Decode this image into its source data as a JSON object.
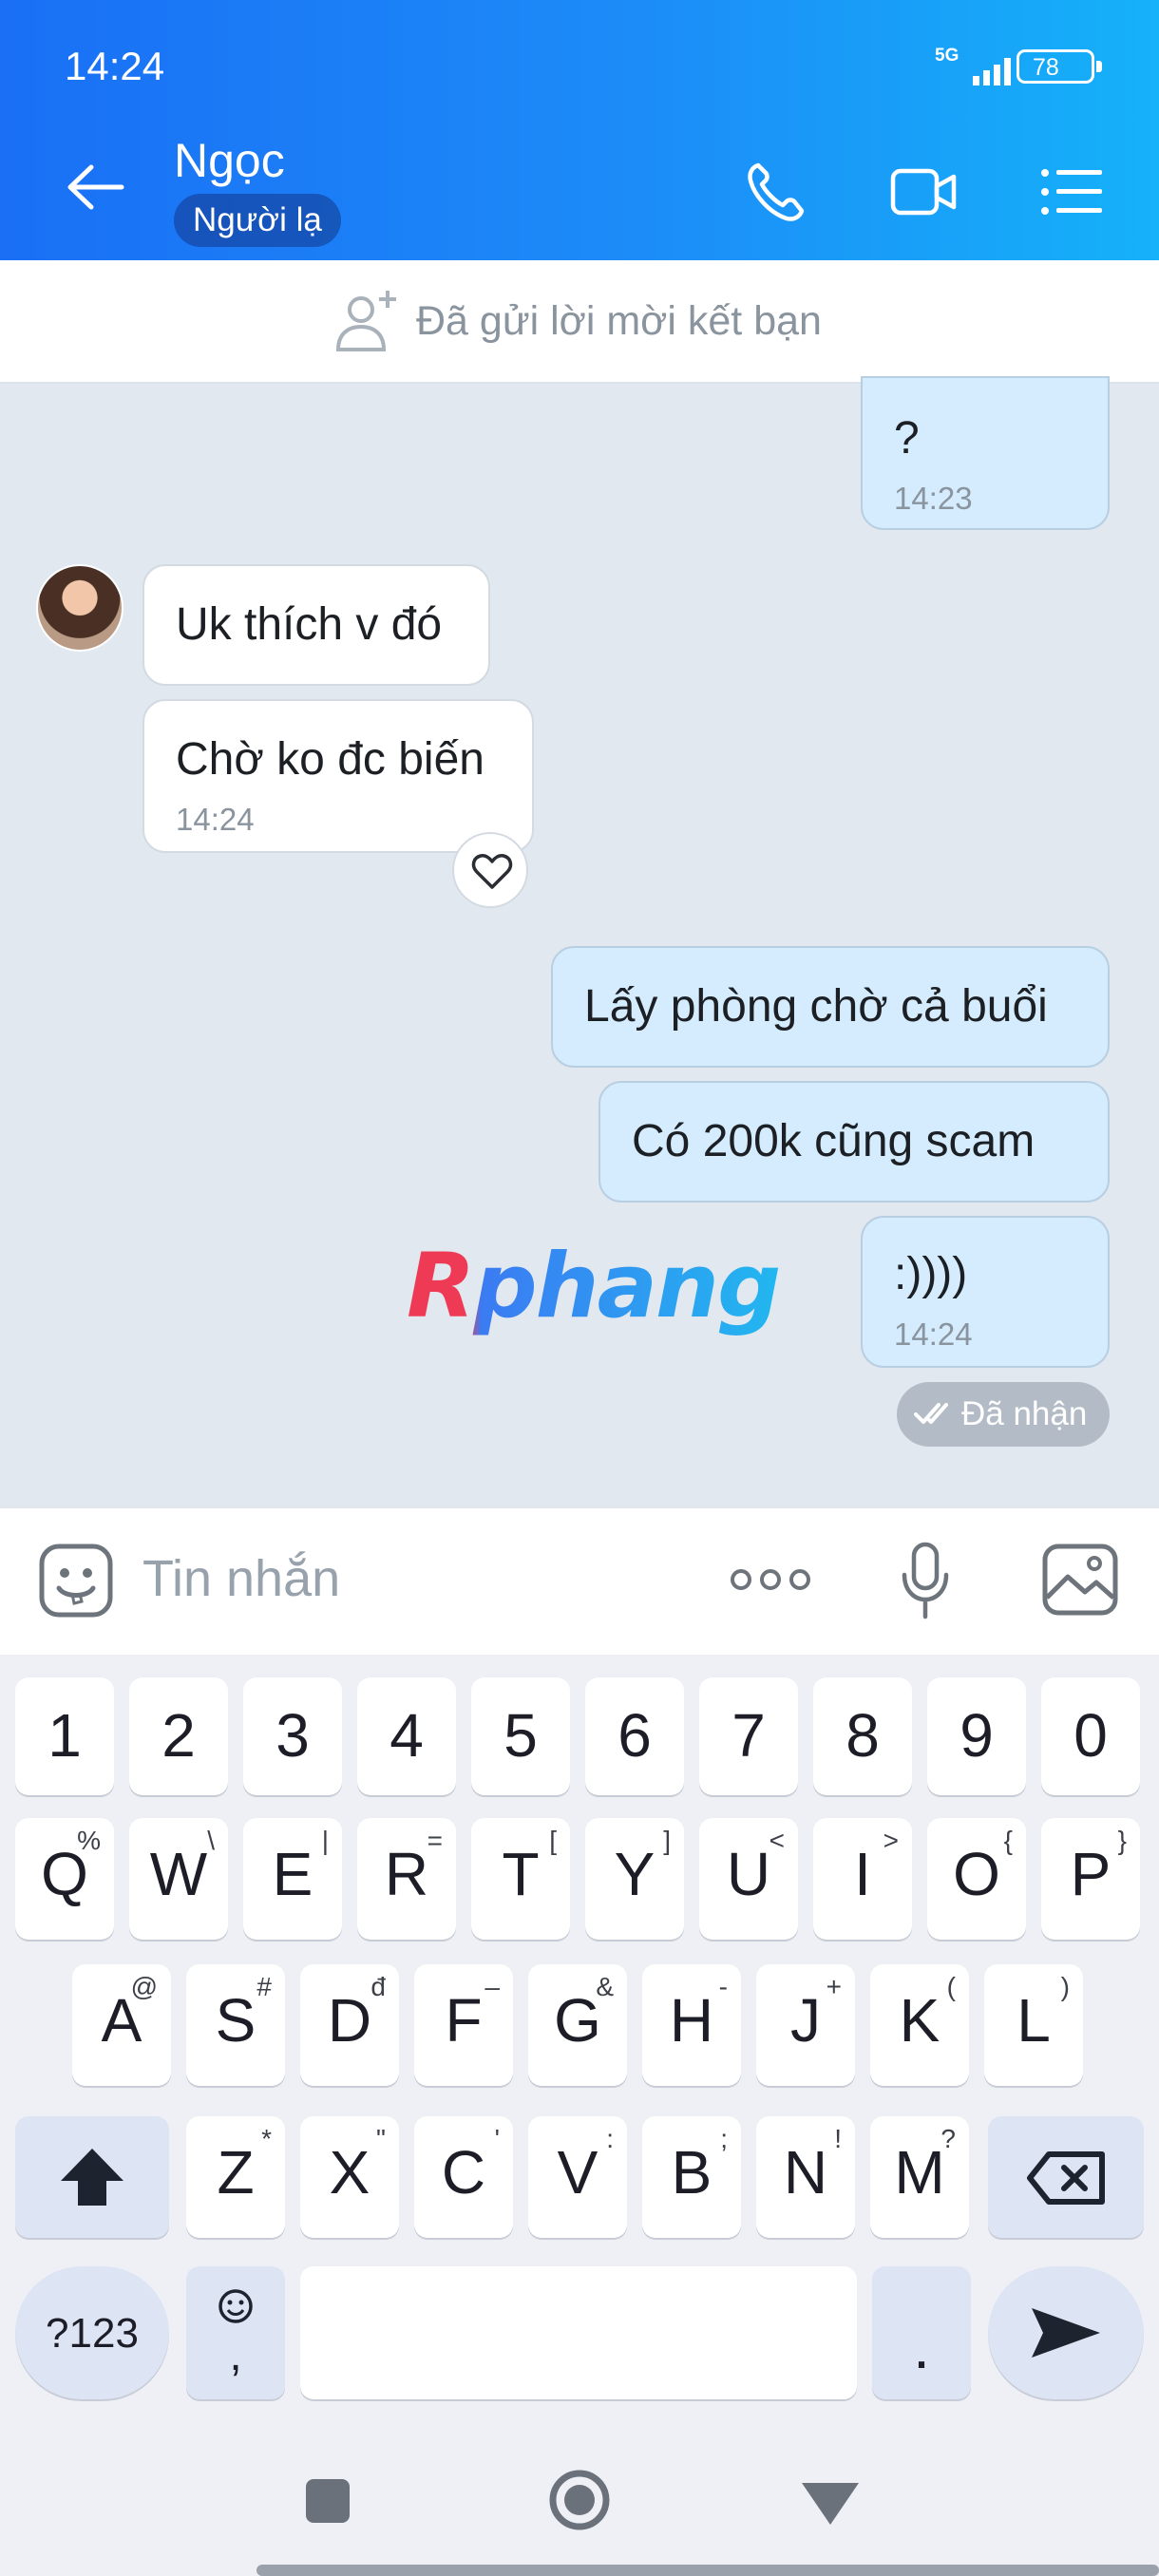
{
  "status": {
    "time": "14:24",
    "network": "5G",
    "battery": "78"
  },
  "header": {
    "contact_name": "Ngọc",
    "badge": "Người lạ",
    "icons": [
      "back-arrow-icon",
      "phone-icon",
      "video-call-icon",
      "menu-list-icon"
    ]
  },
  "friend_request": {
    "text": "Đã gửi lời mời kết bạn",
    "icon": "add-friend-icon"
  },
  "messages": [
    {
      "dir": "out",
      "text": "?",
      "time": "14:23"
    },
    {
      "dir": "in",
      "text": "Uk thích v đó",
      "time": ""
    },
    {
      "dir": "in",
      "text": "Chờ ko đc biến",
      "time": "14:24"
    },
    {
      "dir": "out",
      "text": "Lấy phòng chờ cả buổi",
      "time": ""
    },
    {
      "dir": "out",
      "text": "Có 200k cũng scam",
      "time": ""
    },
    {
      "dir": "out",
      "text": ":))))",
      "time": "14:24"
    }
  ],
  "received_status": "Đã nhận",
  "watermark": "Rphang",
  "input": {
    "placeholder": "Tin nhắn",
    "value": ""
  },
  "keyboard": {
    "row_numbers": [
      "1",
      "2",
      "3",
      "4",
      "5",
      "6",
      "7",
      "8",
      "9",
      "0"
    ],
    "row1": [
      {
        "k": "Q",
        "s": "%"
      },
      {
        "k": "W",
        "s": "\\"
      },
      {
        "k": "E",
        "s": "|"
      },
      {
        "k": "R",
        "s": "="
      },
      {
        "k": "T",
        "s": "["
      },
      {
        "k": "Y",
        "s": "]"
      },
      {
        "k": "U",
        "s": "<"
      },
      {
        "k": "I",
        "s": ">"
      },
      {
        "k": "O",
        "s": "{"
      },
      {
        "k": "P",
        "s": "}"
      }
    ],
    "row2": [
      {
        "k": "A",
        "s": "@"
      },
      {
        "k": "S",
        "s": "#"
      },
      {
        "k": "D",
        "s": "đ"
      },
      {
        "k": "F",
        "s": "–"
      },
      {
        "k": "G",
        "s": "&"
      },
      {
        "k": "H",
        "s": "-"
      },
      {
        "k": "J",
        "s": "+"
      },
      {
        "k": "K",
        "s": "("
      },
      {
        "k": "L",
        "s": ")"
      }
    ],
    "row3": [
      {
        "k": "Z",
        "s": "*"
      },
      {
        "k": "X",
        "s": "\""
      },
      {
        "k": "C",
        "s": "'"
      },
      {
        "k": "V",
        "s": ":"
      },
      {
        "k": "B",
        "s": ";"
      },
      {
        "k": "N",
        "s": "!"
      },
      {
        "k": "M",
        "s": "?"
      }
    ],
    "symbols_label": "?123",
    "emoji_comma_label": ",",
    "period_label": "."
  },
  "colors": {
    "header_start": "#1a6ff5",
    "header_end": "#15b1f9",
    "chat_bg": "#e2e8f0",
    "bubble_out": "#d4ecfd",
    "bubble_in": "#ffffff"
  }
}
